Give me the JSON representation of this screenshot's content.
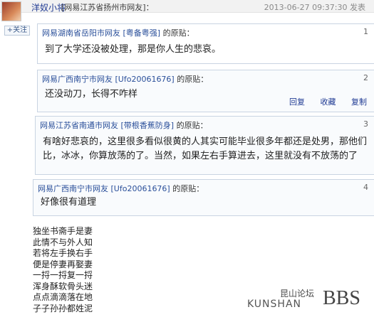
{
  "header": {
    "username": "洋奴小将",
    "location": "[网易江苏省扬州市网友]：",
    "timestamp": "2013-06-27 09:37:30 发表"
  },
  "follow_label": "+关注",
  "quotes": [
    {
      "head_user": "网易湖南省岳阳市网友",
      "head_tag": "[粤备粤强]",
      "head_suffix": "的原贴：",
      "num": "1",
      "text": "到了大学还没被处理，那是你人生的悲哀。"
    },
    {
      "head_user": "网易广西南宁市网友",
      "head_tag": "[Ufo20061676]",
      "head_suffix": "的原贴：",
      "num": "2",
      "text": "还没动刀，长得不咋样",
      "actions": [
        "回复",
        "收藏",
        "复制"
      ]
    },
    {
      "head_user": "网易江苏省南通市网友",
      "head_tag": "[带根香蕉防身]",
      "head_suffix": "的原贴：",
      "num": "3",
      "text": "有啥好悲哀的，这里很多看似很黄的人其实可能毕业很多年都还是处男，那他们比，冰冰，你算放荡的了。当然，如果左右手算进去，这里就没有不放荡的了"
    },
    {
      "head_user": "网易广西南宁市网友",
      "head_tag": "[Ufo20061676]",
      "head_suffix": "的原贴：",
      "num": "4",
      "text": "好像很有道理"
    }
  ],
  "poem_lines": [
    "独坐书斋手是妻",
    "此情不与外人知",
    "若将左手换右手",
    "便是停妻再娶妻",
    "一捋一捋复一捋",
    "浑身酥软骨头迷",
    "点点滴滴落在地",
    "子子孙孙都姓泥"
  ],
  "watermark": {
    "cn": "昆山论坛",
    "en": "KUNSHAN",
    "bbs": "BBS"
  }
}
